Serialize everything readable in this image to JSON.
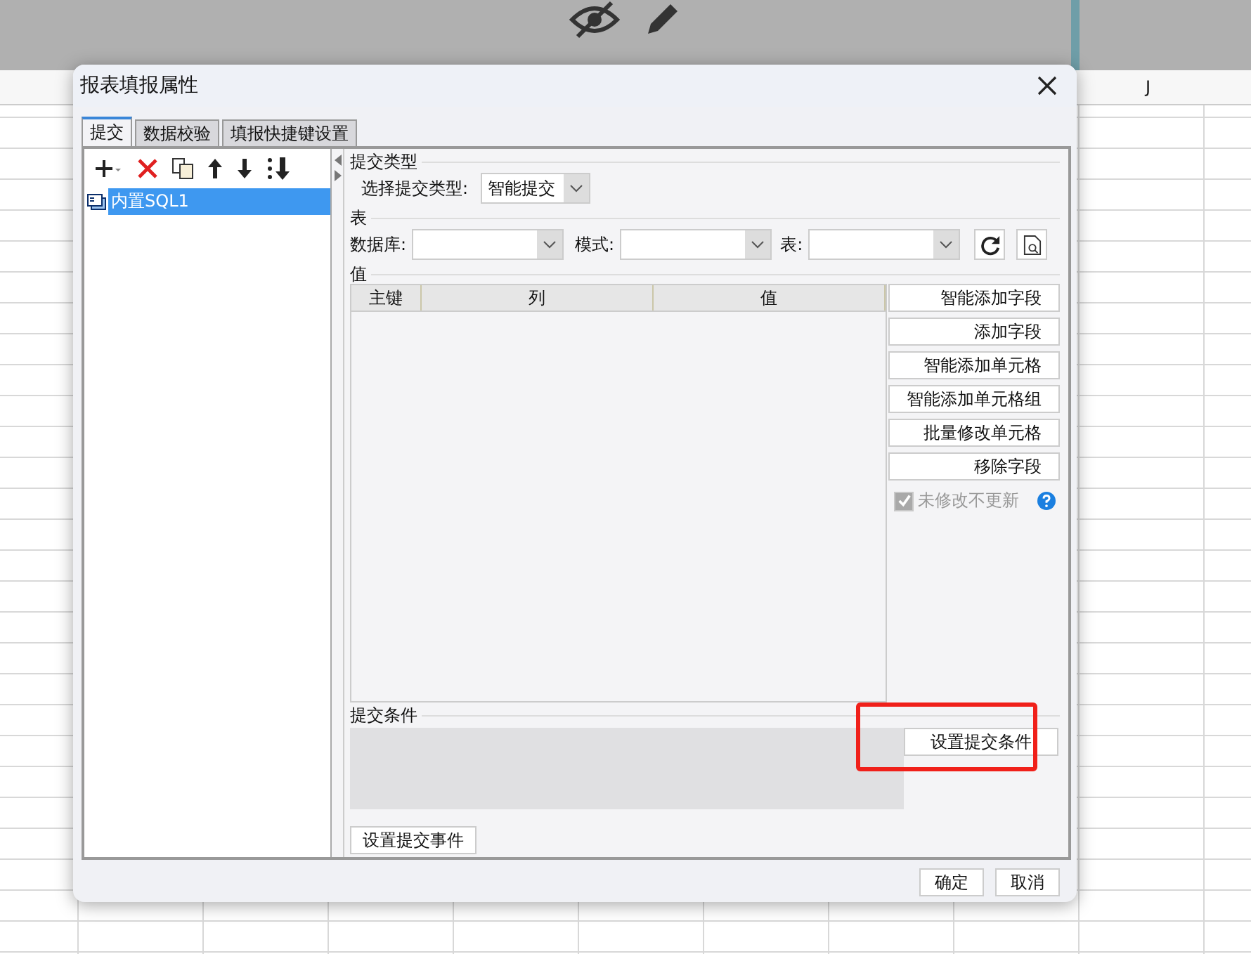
{
  "sheet": {
    "column_header": "J"
  },
  "dialog": {
    "title": "报表填报属性",
    "tabs": [
      {
        "label": "提交",
        "selected": true
      },
      {
        "label": "数据校验",
        "selected": false
      },
      {
        "label": "填报快捷键设置",
        "selected": false
      }
    ],
    "tree": [
      {
        "label": "内置SQL1",
        "selected": true
      }
    ],
    "submit_type": {
      "heading": "提交类型",
      "label": "选择提交类型:",
      "value": "智能提交"
    },
    "table_section": {
      "heading": "表",
      "fields": [
        {
          "label": "数据库:"
        },
        {
          "label": "模式:"
        },
        {
          "label": "表:"
        }
      ]
    },
    "values": {
      "heading": "值",
      "columns": [
        "主键",
        "列",
        "值"
      ],
      "buttons": [
        "智能添加字段",
        "添加字段",
        "智能添加单元格",
        "智能添加单元格组",
        "批量修改单元格",
        "移除字段"
      ],
      "checkbox": {
        "label": "未修改不更新",
        "checked": true,
        "disabled": true
      }
    },
    "condition": {
      "heading": "提交条件",
      "button": "设置提交条件",
      "highlighted": true
    },
    "event_button": "设置提交事件",
    "footer_buttons": [
      "确定",
      "取消"
    ]
  }
}
